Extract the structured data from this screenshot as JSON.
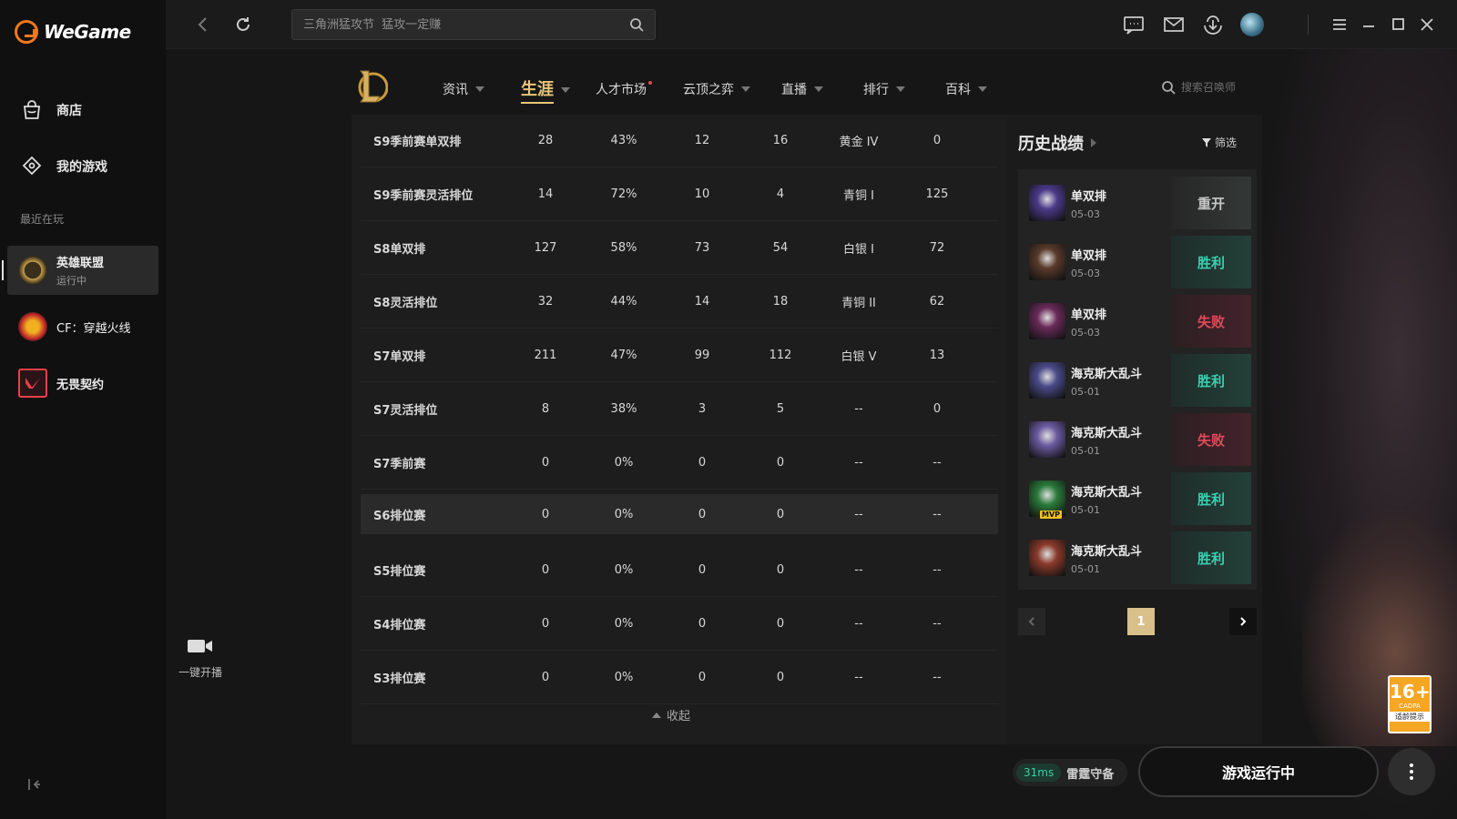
{
  "app": {
    "name": "WeGame"
  },
  "sidebar": {
    "nav": [
      {
        "label": "商店",
        "icon": "shop-bag-icon"
      },
      {
        "label": "我的游戏",
        "icon": "gamepad-icon"
      }
    ],
    "recent_label": "最近在玩",
    "games": [
      {
        "name": "英雄联盟",
        "status": "运行中",
        "active": true
      },
      {
        "name": "CF：穿越火线",
        "status": ""
      },
      {
        "name": "无畏契约",
        "status": ""
      }
    ]
  },
  "topbar": {
    "search_placeholder": "三角洲猛攻节  猛攻一定赚"
  },
  "lol_nav": {
    "tabs": [
      {
        "label": "资讯"
      },
      {
        "label": "生涯",
        "active": true
      },
      {
        "label": "人才市场"
      },
      {
        "label": "云顶之弈"
      },
      {
        "label": "直播"
      },
      {
        "label": "排行"
      },
      {
        "label": "百科"
      }
    ],
    "summoner_search_placeholder": "搜索召唤师"
  },
  "stats": {
    "rows": [
      [
        "S9季前赛单双排",
        "28",
        "43%",
        "12",
        "16",
        "黄金 IV",
        "0"
      ],
      [
        "S9季前赛灵活排位",
        "14",
        "72%",
        "10",
        "4",
        "青铜 I",
        "125"
      ],
      [
        "S8单双排",
        "127",
        "58%",
        "73",
        "54",
        "白银 I",
        "72"
      ],
      [
        "S8灵活排位",
        "32",
        "44%",
        "14",
        "18",
        "青铜 II",
        "62"
      ],
      [
        "S7单双排",
        "211",
        "47%",
        "99",
        "112",
        "白银 V",
        "13"
      ],
      [
        "S7灵活排位",
        "8",
        "38%",
        "3",
        "5",
        "--",
        "0"
      ],
      [
        "S7季前赛",
        "0",
        "0%",
        "0",
        "0",
        "--",
        "--"
      ],
      [
        "S6排位赛",
        "0",
        "0%",
        "0",
        "0",
        "--",
        "--"
      ],
      [
        "S5排位赛",
        "0",
        "0%",
        "0",
        "0",
        "--",
        "--"
      ],
      [
        "S4排位赛",
        "0",
        "0%",
        "0",
        "0",
        "--",
        "--"
      ],
      [
        "S3排位赛",
        "0",
        "0%",
        "0",
        "0",
        "--",
        "--"
      ]
    ],
    "collapse_label": "收起"
  },
  "history": {
    "title": "历史战绩",
    "filter_label": "筛选",
    "matches": [
      {
        "mode": "单双排",
        "date": "05-03",
        "result": "重开",
        "type": "remake",
        "champ_color": "#4b3a8a"
      },
      {
        "mode": "单双排",
        "date": "05-03",
        "result": "胜利",
        "type": "win",
        "champ_color": "#5a3a2a"
      },
      {
        "mode": "单双排",
        "date": "05-03",
        "result": "失败",
        "type": "loss",
        "champ_color": "#6a2a5a"
      },
      {
        "mode": "海克斯大乱斗",
        "date": "05-01",
        "result": "胜利",
        "type": "win",
        "champ_color": "#4a4a8a"
      },
      {
        "mode": "海克斯大乱斗",
        "date": "05-01",
        "result": "失败",
        "type": "loss",
        "champ_color": "#6a5aa0"
      },
      {
        "mode": "海克斯大乱斗",
        "date": "05-01",
        "result": "胜利",
        "type": "win",
        "champ_color": "#2a7a3a",
        "mvp": "MVP"
      },
      {
        "mode": "海克斯大乱斗",
        "date": "05-01",
        "result": "胜利",
        "type": "win",
        "champ_color": "#8a3a2a"
      }
    ],
    "page": "1"
  },
  "streaming": {
    "label": "一键开播"
  },
  "age_rating": {
    "age": "16+",
    "org": "CADPA",
    "tip": "适龄提示"
  },
  "footer": {
    "ping": "31ms",
    "server": "雷霆守备",
    "launch_label": "游戏运行中"
  }
}
